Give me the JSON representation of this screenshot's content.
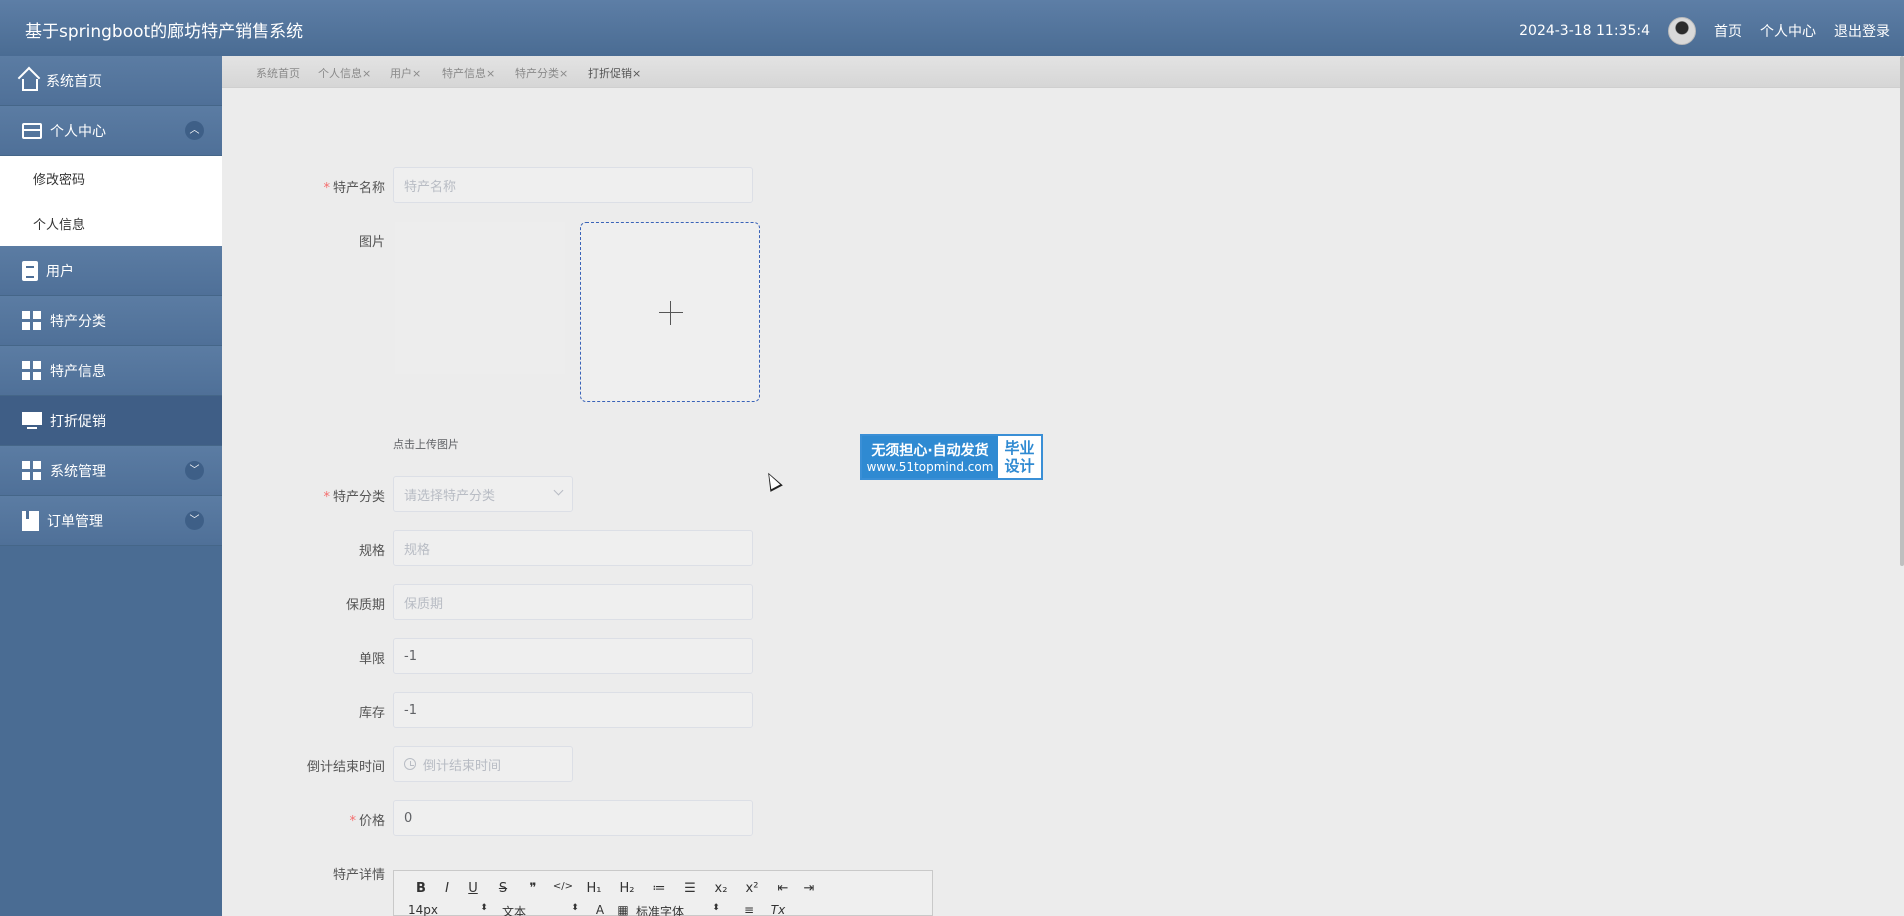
{
  "header": {
    "title": "基于springboot的廊坊特产销售系统",
    "datetime": "2024-3-18 11:35:4",
    "links": [
      "首页",
      "个人中心",
      "退出登录"
    ]
  },
  "sidebar": {
    "items": [
      {
        "label": "系统首页",
        "icon": "home-icon"
      },
      {
        "label": "个人中心",
        "icon": "card-icon",
        "expanded": true
      },
      {
        "label": "修改密码",
        "sub": true
      },
      {
        "label": "个人信息",
        "sub": true
      },
      {
        "label": "用户",
        "icon": "clipboard-icon"
      },
      {
        "label": "特产分类",
        "icon": "grid-icon"
      },
      {
        "label": "特产信息",
        "icon": "grid-icon"
      },
      {
        "label": "打折促销",
        "icon": "monitor-icon",
        "active": true
      },
      {
        "label": "系统管理",
        "icon": "grid-icon",
        "collapsible": true
      },
      {
        "label": "订单管理",
        "icon": "book-icon",
        "collapsible": true
      }
    ]
  },
  "tabs": [
    {
      "label": "系统首页",
      "closable": false
    },
    {
      "label": "个人信息",
      "closable": true
    },
    {
      "label": "用户",
      "closable": true
    },
    {
      "label": "特产信息",
      "closable": true
    },
    {
      "label": "特产分类",
      "closable": true
    },
    {
      "label": "打折促销",
      "closable": true,
      "active": true
    }
  ],
  "tab_close_glyph": "×",
  "form": {
    "name": {
      "label": "特产名称",
      "placeholder": "特产名称",
      "required": true
    },
    "image": {
      "label": "图片",
      "tip": "点击上传图片"
    },
    "category": {
      "label": "特产分类",
      "placeholder": "请选择特产分类",
      "required": true
    },
    "spec": {
      "label": "规格",
      "placeholder": "规格"
    },
    "shelf_life": {
      "label": "保质期",
      "placeholder": "保质期"
    },
    "limit": {
      "label": "单限",
      "value": "-1"
    },
    "stock": {
      "label": "库存",
      "value": "-1"
    },
    "countdown": {
      "label": "倒计结束时间",
      "placeholder": "倒计结束时间"
    },
    "price": {
      "label": "价格",
      "value": "0",
      "required": true
    },
    "detail": {
      "label": "特产详情"
    }
  },
  "editor": {
    "row1": [
      "B",
      "I",
      "U",
      "S",
      "❞",
      "</>",
      "H₁",
      "H₂",
      "≔",
      "☰",
      "x₂",
      "x²",
      "⇤",
      "⇥"
    ],
    "row2": [
      "14px",
      "⬍",
      "文本",
      "⬍",
      "A",
      "▦",
      "标准字体",
      "⬍",
      "≡",
      "Tx"
    ]
  },
  "watermark": {
    "line1": "无须担心·自动发货",
    "line2": "www.51topmind.com",
    "right1": "毕业",
    "right2": "设计"
  },
  "required_mark": "*"
}
